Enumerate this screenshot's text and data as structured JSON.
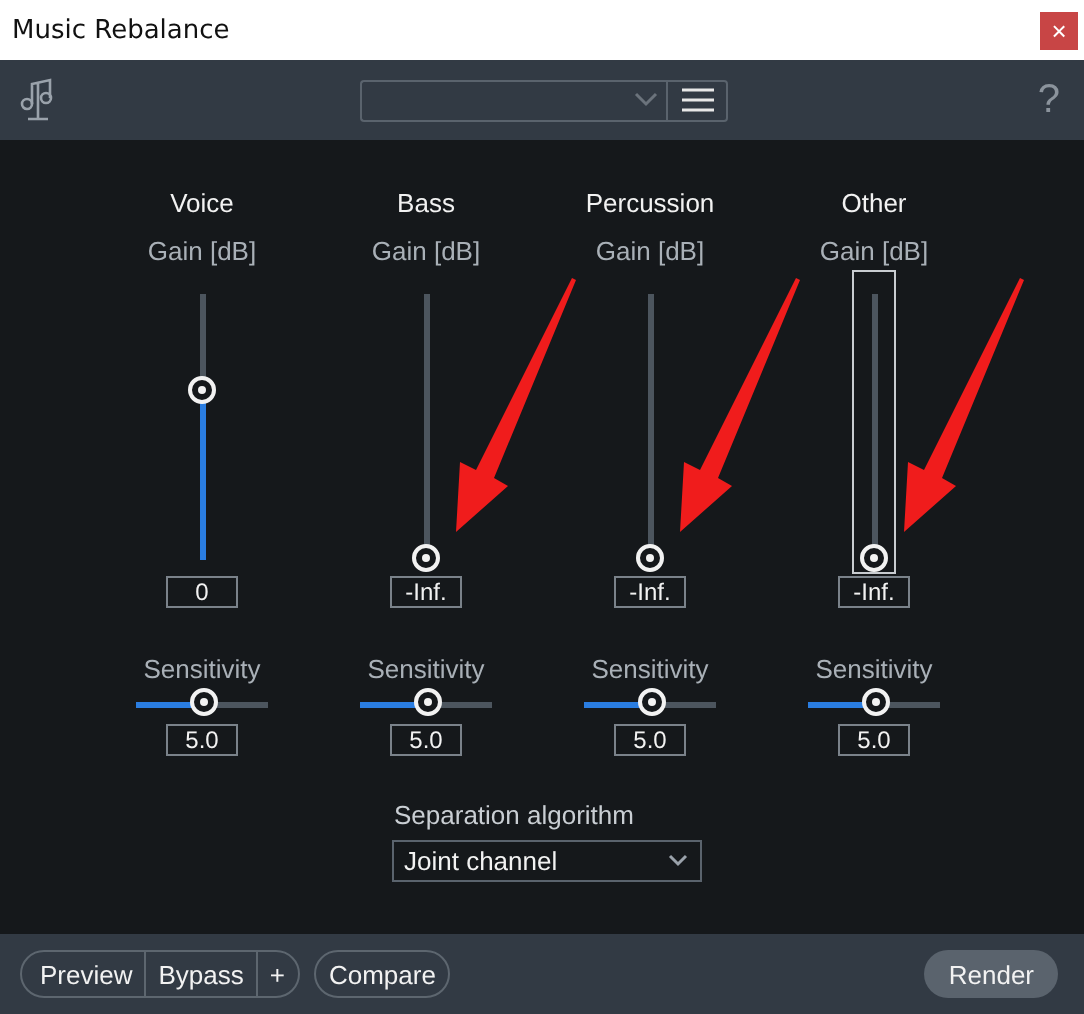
{
  "window": {
    "title": "Music Rebalance",
    "close": "×"
  },
  "toolbar": {
    "help": "?"
  },
  "channels": [
    {
      "name": "Voice",
      "gain_label": "Gain [dB]",
      "level": 0.63,
      "value": "0",
      "focused": false,
      "annotated": false,
      "sensitivity_label": "Sensitivity",
      "sensitivity": {
        "level": 0.5,
        "value": "5.0"
      }
    },
    {
      "name": "Bass",
      "gain_label": "Gain [dB]",
      "level": 0,
      "value": "-Inf.",
      "focused": false,
      "annotated": true,
      "sensitivity_label": "Sensitivity",
      "sensitivity": {
        "level": 0.5,
        "value": "5.0"
      }
    },
    {
      "name": "Percussion",
      "gain_label": "Gain [dB]",
      "level": 0,
      "value": "-Inf.",
      "focused": false,
      "annotated": true,
      "sensitivity_label": "Sensitivity",
      "sensitivity": {
        "level": 0.5,
        "value": "5.0"
      }
    },
    {
      "name": "Other",
      "gain_label": "Gain [dB]",
      "level": 0,
      "value": "-Inf.",
      "focused": true,
      "annotated": true,
      "sensitivity_label": "Sensitivity",
      "sensitivity": {
        "level": 0.5,
        "value": "5.0"
      }
    }
  ],
  "algorithm": {
    "label": "Separation algorithm",
    "value": "Joint channel"
  },
  "footer": {
    "buttons": [
      "Preview",
      "Bypass",
      "+"
    ],
    "compare": "Compare",
    "render": "Render"
  }
}
